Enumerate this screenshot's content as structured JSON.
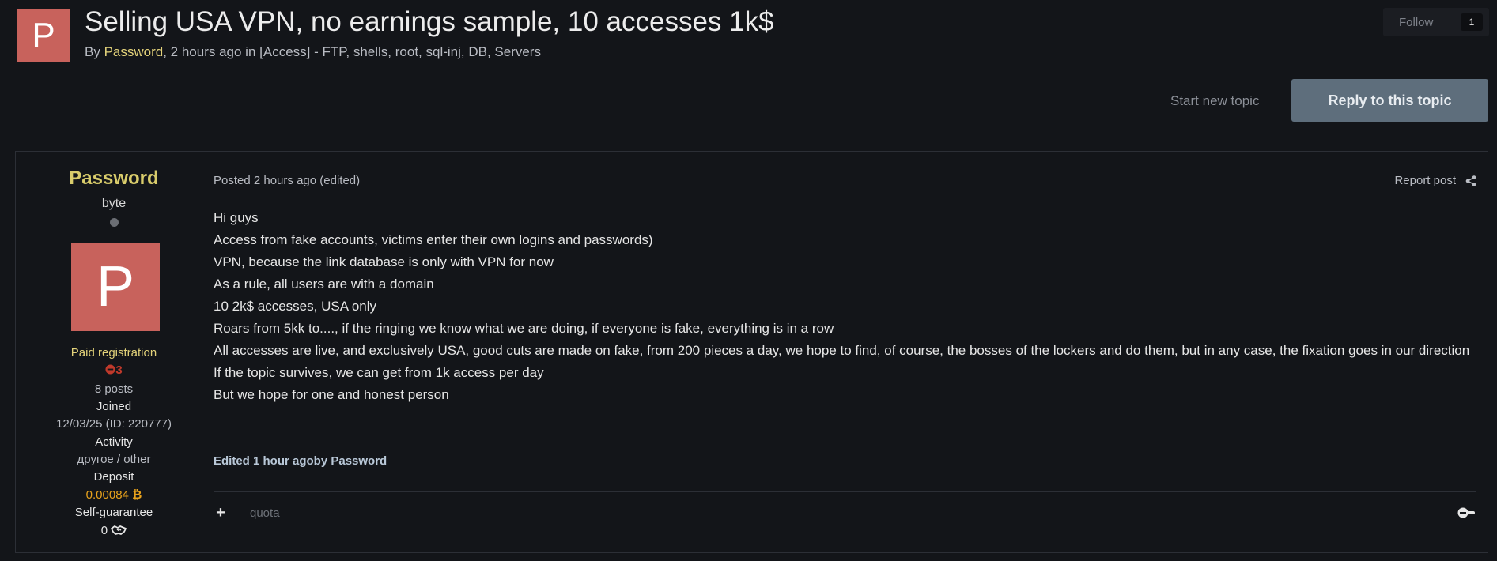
{
  "topic": {
    "avatar_letter": "P",
    "title": "Selling USA VPN, no earnings sample, 10 accesses 1k$",
    "by_label": "By",
    "author": "Password",
    "meta_rest": ", 2 hours ago in [Access] - FTP, shells, root, sql-inj, DB, Servers"
  },
  "follow": {
    "label": "Follow",
    "count": "1"
  },
  "actions": {
    "start_topic": "Start new topic",
    "reply": "Reply to this topic"
  },
  "post": {
    "author": {
      "name": "Password",
      "rank": "byte",
      "avatar_letter": "P",
      "group": "Paid registration",
      "reputation": "3",
      "posts": "8 posts",
      "joined_label": "Joined",
      "joined_value": "12/03/25 (ID: 220777)",
      "activity_label": "Activity",
      "activity_value": "другое / other",
      "deposit_label": "Deposit",
      "deposit_value": "0.00084",
      "guarantee_label": "Self-guarantee",
      "guarantee_value": "0"
    },
    "posted": "Posted 2 hours ago (edited)",
    "report": "Report post",
    "lines": [
      "Hi guys",
      "Access from fake accounts, victims enter their own logins and passwords)",
      "VPN, because the link database is only with VPN for now",
      "As a rule, all users are with a domain",
      "10 2k$ accesses, USA only",
      "Roars from 5kk to...., if the ringing we know what we are doing, if everyone is fake, everything is in a row",
      "All accesses are live, and exclusively USA, good cuts are made on fake, from 200 pieces a day, we hope to find, of course, the bosses of the lockers and do them, but in any case, the fixation goes in our direction",
      "If the topic survives, we can get from 1k access per day",
      "But we hope for one and honest person"
    ],
    "edited": "Edited 1 hour agoby Password",
    "quote_label": "quota"
  },
  "colors": {
    "accent_yellow": "#e3d27a",
    "avatar_bg": "#c8625c",
    "reply_btn": "#5e6e7c",
    "deposit": "#e8a21c",
    "reputation": "#c0392b"
  }
}
